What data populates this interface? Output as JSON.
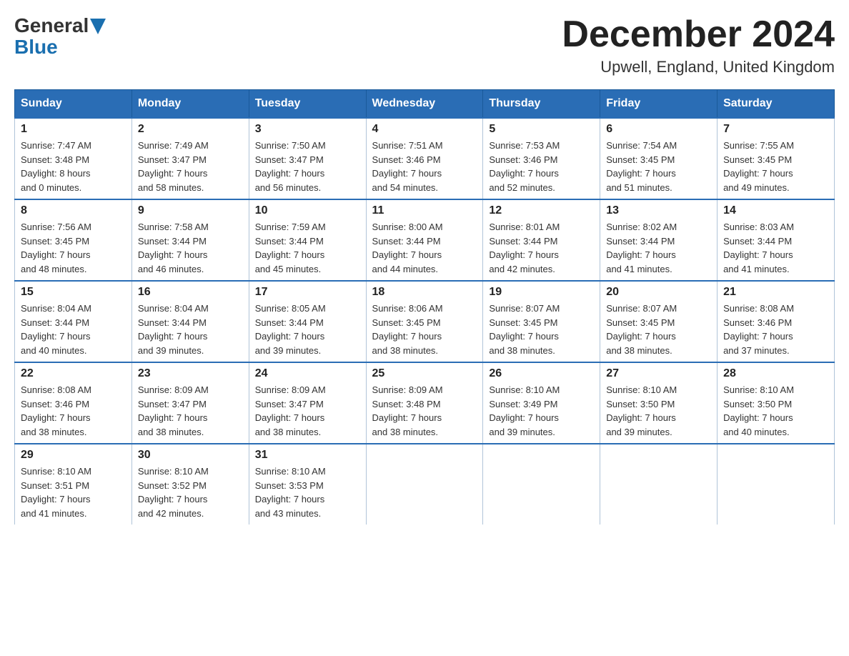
{
  "header": {
    "logo_general": "General",
    "logo_blue": "Blue",
    "month_title": "December 2024",
    "location": "Upwell, England, United Kingdom"
  },
  "weekdays": [
    "Sunday",
    "Monday",
    "Tuesday",
    "Wednesday",
    "Thursday",
    "Friday",
    "Saturday"
  ],
  "weeks": [
    [
      {
        "day": "1",
        "sunrise": "Sunrise: 7:47 AM",
        "sunset": "Sunset: 3:48 PM",
        "daylight": "Daylight: 8 hours",
        "daylight2": "and 0 minutes."
      },
      {
        "day": "2",
        "sunrise": "Sunrise: 7:49 AM",
        "sunset": "Sunset: 3:47 PM",
        "daylight": "Daylight: 7 hours",
        "daylight2": "and 58 minutes."
      },
      {
        "day": "3",
        "sunrise": "Sunrise: 7:50 AM",
        "sunset": "Sunset: 3:47 PM",
        "daylight": "Daylight: 7 hours",
        "daylight2": "and 56 minutes."
      },
      {
        "day": "4",
        "sunrise": "Sunrise: 7:51 AM",
        "sunset": "Sunset: 3:46 PM",
        "daylight": "Daylight: 7 hours",
        "daylight2": "and 54 minutes."
      },
      {
        "day": "5",
        "sunrise": "Sunrise: 7:53 AM",
        "sunset": "Sunset: 3:46 PM",
        "daylight": "Daylight: 7 hours",
        "daylight2": "and 52 minutes."
      },
      {
        "day": "6",
        "sunrise": "Sunrise: 7:54 AM",
        "sunset": "Sunset: 3:45 PM",
        "daylight": "Daylight: 7 hours",
        "daylight2": "and 51 minutes."
      },
      {
        "day": "7",
        "sunrise": "Sunrise: 7:55 AM",
        "sunset": "Sunset: 3:45 PM",
        "daylight": "Daylight: 7 hours",
        "daylight2": "and 49 minutes."
      }
    ],
    [
      {
        "day": "8",
        "sunrise": "Sunrise: 7:56 AM",
        "sunset": "Sunset: 3:45 PM",
        "daylight": "Daylight: 7 hours",
        "daylight2": "and 48 minutes."
      },
      {
        "day": "9",
        "sunrise": "Sunrise: 7:58 AM",
        "sunset": "Sunset: 3:44 PM",
        "daylight": "Daylight: 7 hours",
        "daylight2": "and 46 minutes."
      },
      {
        "day": "10",
        "sunrise": "Sunrise: 7:59 AM",
        "sunset": "Sunset: 3:44 PM",
        "daylight": "Daylight: 7 hours",
        "daylight2": "and 45 minutes."
      },
      {
        "day": "11",
        "sunrise": "Sunrise: 8:00 AM",
        "sunset": "Sunset: 3:44 PM",
        "daylight": "Daylight: 7 hours",
        "daylight2": "and 44 minutes."
      },
      {
        "day": "12",
        "sunrise": "Sunrise: 8:01 AM",
        "sunset": "Sunset: 3:44 PM",
        "daylight": "Daylight: 7 hours",
        "daylight2": "and 42 minutes."
      },
      {
        "day": "13",
        "sunrise": "Sunrise: 8:02 AM",
        "sunset": "Sunset: 3:44 PM",
        "daylight": "Daylight: 7 hours",
        "daylight2": "and 41 minutes."
      },
      {
        "day": "14",
        "sunrise": "Sunrise: 8:03 AM",
        "sunset": "Sunset: 3:44 PM",
        "daylight": "Daylight: 7 hours",
        "daylight2": "and 41 minutes."
      }
    ],
    [
      {
        "day": "15",
        "sunrise": "Sunrise: 8:04 AM",
        "sunset": "Sunset: 3:44 PM",
        "daylight": "Daylight: 7 hours",
        "daylight2": "and 40 minutes."
      },
      {
        "day": "16",
        "sunrise": "Sunrise: 8:04 AM",
        "sunset": "Sunset: 3:44 PM",
        "daylight": "Daylight: 7 hours",
        "daylight2": "and 39 minutes."
      },
      {
        "day": "17",
        "sunrise": "Sunrise: 8:05 AM",
        "sunset": "Sunset: 3:44 PM",
        "daylight": "Daylight: 7 hours",
        "daylight2": "and 39 minutes."
      },
      {
        "day": "18",
        "sunrise": "Sunrise: 8:06 AM",
        "sunset": "Sunset: 3:45 PM",
        "daylight": "Daylight: 7 hours",
        "daylight2": "and 38 minutes."
      },
      {
        "day": "19",
        "sunrise": "Sunrise: 8:07 AM",
        "sunset": "Sunset: 3:45 PM",
        "daylight": "Daylight: 7 hours",
        "daylight2": "and 38 minutes."
      },
      {
        "day": "20",
        "sunrise": "Sunrise: 8:07 AM",
        "sunset": "Sunset: 3:45 PM",
        "daylight": "Daylight: 7 hours",
        "daylight2": "and 38 minutes."
      },
      {
        "day": "21",
        "sunrise": "Sunrise: 8:08 AM",
        "sunset": "Sunset: 3:46 PM",
        "daylight": "Daylight: 7 hours",
        "daylight2": "and 37 minutes."
      }
    ],
    [
      {
        "day": "22",
        "sunrise": "Sunrise: 8:08 AM",
        "sunset": "Sunset: 3:46 PM",
        "daylight": "Daylight: 7 hours",
        "daylight2": "and 38 minutes."
      },
      {
        "day": "23",
        "sunrise": "Sunrise: 8:09 AM",
        "sunset": "Sunset: 3:47 PM",
        "daylight": "Daylight: 7 hours",
        "daylight2": "and 38 minutes."
      },
      {
        "day": "24",
        "sunrise": "Sunrise: 8:09 AM",
        "sunset": "Sunset: 3:47 PM",
        "daylight": "Daylight: 7 hours",
        "daylight2": "and 38 minutes."
      },
      {
        "day": "25",
        "sunrise": "Sunrise: 8:09 AM",
        "sunset": "Sunset: 3:48 PM",
        "daylight": "Daylight: 7 hours",
        "daylight2": "and 38 minutes."
      },
      {
        "day": "26",
        "sunrise": "Sunrise: 8:10 AM",
        "sunset": "Sunset: 3:49 PM",
        "daylight": "Daylight: 7 hours",
        "daylight2": "and 39 minutes."
      },
      {
        "day": "27",
        "sunrise": "Sunrise: 8:10 AM",
        "sunset": "Sunset: 3:50 PM",
        "daylight": "Daylight: 7 hours",
        "daylight2": "and 39 minutes."
      },
      {
        "day": "28",
        "sunrise": "Sunrise: 8:10 AM",
        "sunset": "Sunset: 3:50 PM",
        "daylight": "Daylight: 7 hours",
        "daylight2": "and 40 minutes."
      }
    ],
    [
      {
        "day": "29",
        "sunrise": "Sunrise: 8:10 AM",
        "sunset": "Sunset: 3:51 PM",
        "daylight": "Daylight: 7 hours",
        "daylight2": "and 41 minutes."
      },
      {
        "day": "30",
        "sunrise": "Sunrise: 8:10 AM",
        "sunset": "Sunset: 3:52 PM",
        "daylight": "Daylight: 7 hours",
        "daylight2": "and 42 minutes."
      },
      {
        "day": "31",
        "sunrise": "Sunrise: 8:10 AM",
        "sunset": "Sunset: 3:53 PM",
        "daylight": "Daylight: 7 hours",
        "daylight2": "and 43 minutes."
      },
      null,
      null,
      null,
      null
    ]
  ]
}
